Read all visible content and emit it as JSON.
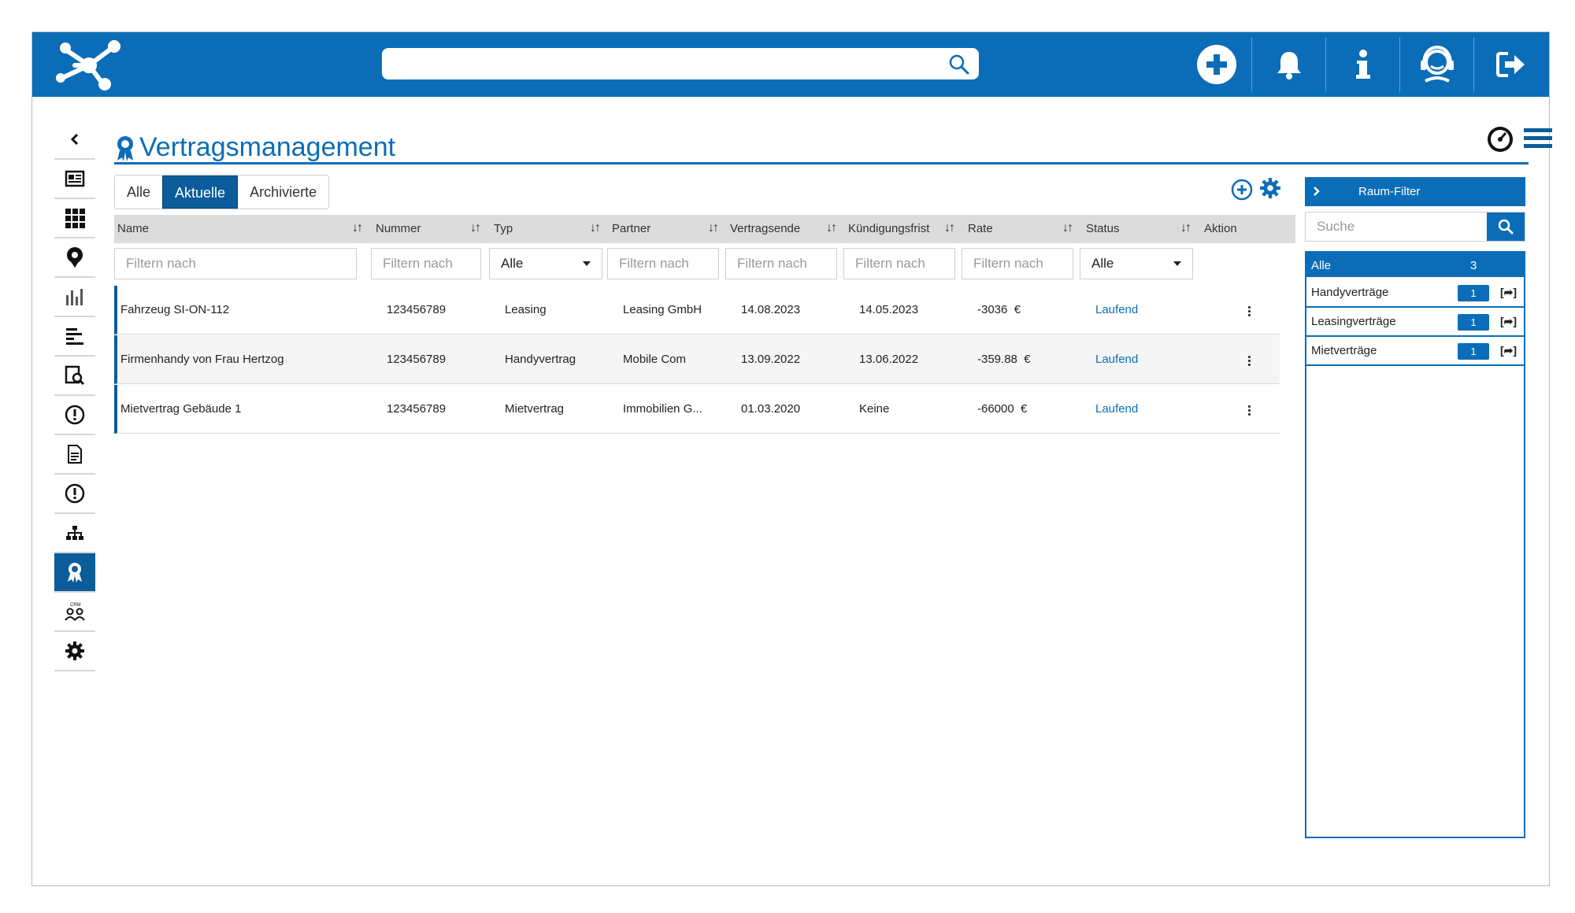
{
  "header": {
    "search_placeholder": "",
    "icons": [
      "logo-network-icon",
      "search-icon",
      "add-circle-icon",
      "bell-icon",
      "info-icon",
      "support-agent-icon",
      "logout-icon"
    ]
  },
  "sidebar": {
    "items": [
      "collapse-chevron-icon",
      "dashboard-icon",
      "apps-grid-icon",
      "location-pin-icon",
      "bar-chart-icon",
      "list-icon",
      "report-search-icon",
      "alert-icon",
      "document-icon",
      "alert-icon",
      "hierarchy-icon",
      "award-icon",
      "crm-icon",
      "gear-icon"
    ],
    "active_index": 11
  },
  "page": {
    "title": "Vertragsmanagement"
  },
  "tabs": [
    {
      "label": "Alle",
      "active": false
    },
    {
      "label": "Aktuelle",
      "active": true
    },
    {
      "label": "Archivierte",
      "active": false
    }
  ],
  "table": {
    "columns": [
      "Name",
      "Nummer",
      "Typ",
      "Partner",
      "Vertragsende",
      "Kündigungsfrist",
      "Rate",
      "Status",
      "Aktion"
    ],
    "filters": {
      "placeholder": "Filtern nach",
      "select_value": "Alle"
    },
    "rows": [
      {
        "name": "Fahrzeug SI-ON-112",
        "nummer": "123456789",
        "typ": "Leasing",
        "partner": "Leasing GmbH",
        "vertragsende": "14.08.2023",
        "kuendigungsfrist": "14.05.2023",
        "rate": "-3036  €",
        "status": "Laufend"
      },
      {
        "name": "Firmenhandy von Frau Hertzog",
        "nummer": "123456789",
        "typ": "Handyvertrag",
        "partner": "Mobile Com",
        "vertragsende": "13.09.2022",
        "kuendigungsfrist": "13.06.2022",
        "rate": "-359.88  €",
        "status": "Laufend"
      },
      {
        "name": "Mietvertrag Gebäude 1",
        "nummer": "123456789",
        "typ": "Mietvertrag",
        "partner": "Immobilien G...",
        "vertragsende": "01.03.2020",
        "kuendigungsfrist": "Keine",
        "rate": "-66000  €",
        "status": "Laufend"
      }
    ]
  },
  "right_panel": {
    "header": "Raum-Filter",
    "search_placeholder": "Suche",
    "items": [
      {
        "label": "Alle",
        "count": "3"
      },
      {
        "label": "Handyverträge",
        "count": "1",
        "share": "[➦]"
      },
      {
        "label": "Leasingverträge",
        "count": "1",
        "share": "[➦]"
      },
      {
        "label": "Mietverträge",
        "count": "1",
        "share": "[➦]"
      }
    ]
  },
  "colors": {
    "brand": "#0b6db7",
    "active": "#0b5c9b",
    "header_bg": "#dcdcdc"
  }
}
